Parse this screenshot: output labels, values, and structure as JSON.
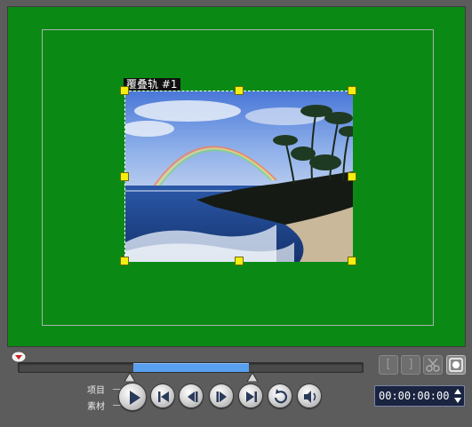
{
  "preview": {
    "overlay_label": "覆叠轨 #1",
    "background_color": "#0a8a14"
  },
  "transport": {
    "mode_project_label": "项目",
    "mode_clip_label": "素材",
    "buttons": [
      "play-icon",
      "go-to-start-icon",
      "previous-frame-icon",
      "next-frame-icon",
      "go-to-end-icon",
      "repeat-icon",
      "volume-icon"
    ]
  },
  "side_buttons": {
    "mark_in_label": "[",
    "mark_out_label": "]",
    "cut_icon": "scissors-icon",
    "enlarge_icon": "enlarge-preview-icon"
  },
  "timecode": {
    "value": "00:00:00:00"
  },
  "colors": {
    "trim_range": "#5aa0f0",
    "handle": "#f5ee10",
    "timecode_bg": "#1a2440"
  }
}
